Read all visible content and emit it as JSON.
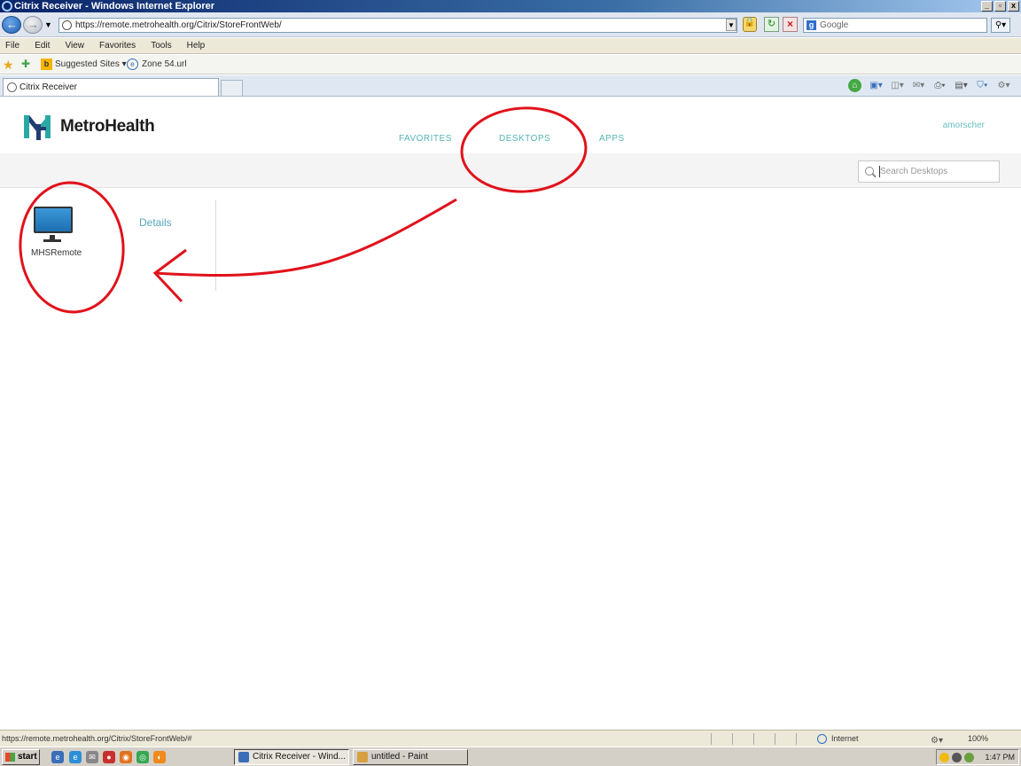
{
  "window": {
    "title": "Citrix Receiver - Windows Internet Explorer",
    "minimize": "_",
    "restore": "▫",
    "close": "x"
  },
  "address_bar": {
    "url": "https://remote.metrohealth.org/Citrix/StoreFrontWeb/",
    "search_placeholder": "Google"
  },
  "menu": [
    "File",
    "Edit",
    "View",
    "Favorites",
    "Tools",
    "Help"
  ],
  "favorites_bar": {
    "items": [
      "Suggested Sites ▾",
      "Zone 54.url"
    ]
  },
  "tabs": {
    "active_label": "Citrix Receiver"
  },
  "page": {
    "brand": "MetroHealth",
    "nav": {
      "favorites": "FAVORITES",
      "desktops": "DESKTOPS",
      "apps": "APPS"
    },
    "user": "amorscher",
    "search_placeholder": "Search Desktops",
    "desktop": {
      "name": "MHSRemote",
      "details_label": "Details"
    }
  },
  "status_bar": {
    "url": "https://remote.metrohealth.org/Citrix/StoreFrontWeb/#",
    "zone": "Internet",
    "zoom": "100%"
  },
  "taskbar": {
    "start": "start",
    "windows": [
      "Citrix Receiver - Wind...",
      "untitled - Paint"
    ],
    "time": "1:47 PM"
  },
  "colors": {
    "accent_teal": "#56b5b5",
    "brand_teal": "#2aa9a4",
    "brand_navy": "#1f3d73",
    "annotation_red": "#e0121b"
  },
  "icons": [
    "back-icon",
    "forward-icon",
    "lock-icon",
    "refresh-icon",
    "stop-icon",
    "google-icon",
    "star-icon",
    "bing-icon",
    "monitor-icon",
    "search-icon",
    "globe-icon",
    "windows-flag-icon"
  ]
}
